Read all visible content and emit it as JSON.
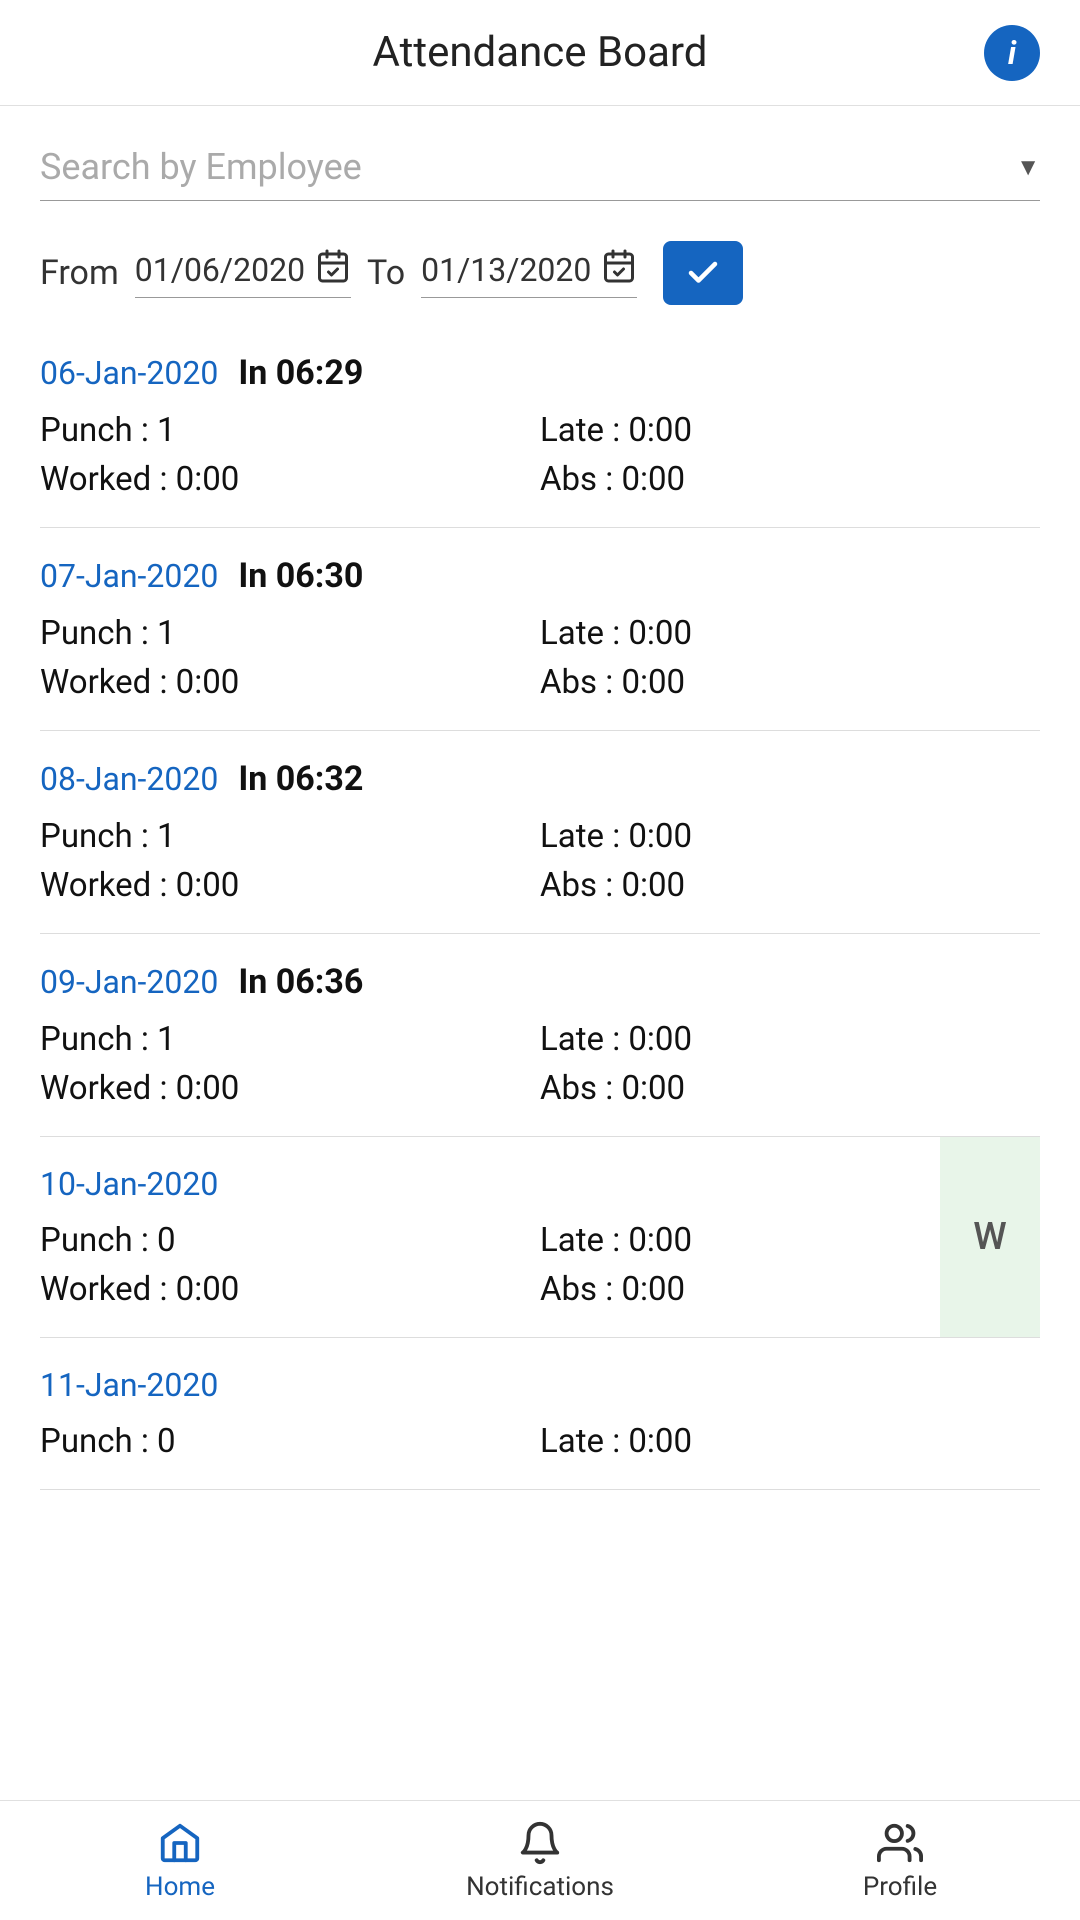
{
  "header": {
    "title": "Attendance Board",
    "info_icon": "info-icon"
  },
  "search": {
    "placeholder": "Search by Employee",
    "dropdown_arrow": "▼"
  },
  "date_filter": {
    "from_label": "From",
    "from_value": "01/06/2020",
    "to_label": "To",
    "to_value": "01/13/2020",
    "confirm_label": "✓"
  },
  "records": [
    {
      "date": "06-Jan-2020",
      "in_time": "In 06:29",
      "punch": "Punch : 1",
      "late": "Late : 0:00",
      "worked": "Worked : 0:00",
      "abs": "Abs : 0:00",
      "weekend": false
    },
    {
      "date": "07-Jan-2020",
      "in_time": "In 06:30",
      "punch": "Punch : 1",
      "late": "Late : 0:00",
      "worked": "Worked : 0:00",
      "abs": "Abs : 0:00",
      "weekend": false
    },
    {
      "date": "08-Jan-2020",
      "in_time": "In 06:32",
      "punch": "Punch : 1",
      "late": "Late : 0:00",
      "worked": "Worked : 0:00",
      "abs": "Abs : 0:00",
      "weekend": false
    },
    {
      "date": "09-Jan-2020",
      "in_time": "In 06:36",
      "punch": "Punch : 1",
      "late": "Late : 0:00",
      "worked": "Worked : 0:00",
      "abs": "Abs : 0:00",
      "weekend": false
    },
    {
      "date": "10-Jan-2020",
      "in_time": "",
      "punch": "Punch : 0",
      "late": "Late : 0:00",
      "worked": "Worked : 0:00",
      "abs": "Abs : 0:00",
      "weekend": true,
      "weekend_label": "W"
    },
    {
      "date": "11-Jan-2020",
      "in_time": "",
      "punch": "Punch : 0",
      "late": "Late : 0:00",
      "worked": "",
      "abs": "",
      "weekend": false
    }
  ],
  "bottom_nav": {
    "items": [
      {
        "label": "Home",
        "icon": "home-icon",
        "active": true
      },
      {
        "label": "Notifications",
        "icon": "bell-icon",
        "active": false
      },
      {
        "label": "Profile",
        "icon": "profile-icon",
        "active": false
      }
    ]
  }
}
